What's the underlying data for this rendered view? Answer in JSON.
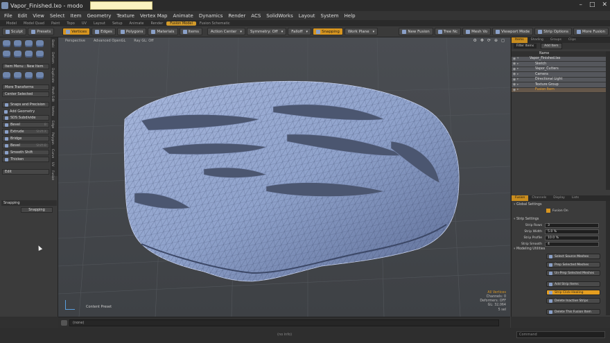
{
  "window": {
    "title": "Vapor_Finished.lxo - modo",
    "controls": [
      "–",
      "□",
      "✕"
    ]
  },
  "menu": [
    "File",
    "Edit",
    "View",
    "Select",
    "Item",
    "Geometry",
    "Texture",
    "Vertex Map",
    "Animate",
    "Dynamics",
    "Render",
    "ACS",
    "SolidWorks",
    "Layout",
    "System",
    "Help"
  ],
  "layout_tabs": [
    {
      "label": "Model",
      "active": false
    },
    {
      "label": "Model Quad",
      "active": false
    },
    {
      "label": "Paint",
      "active": false
    },
    {
      "label": "Topo",
      "active": false
    },
    {
      "label": "UV",
      "active": false
    },
    {
      "label": "Layout",
      "active": false
    },
    {
      "label": "Setup",
      "active": false
    },
    {
      "label": "Animate",
      "active": false
    },
    {
      "label": "Render",
      "active": false
    },
    {
      "label": "Fusion Model",
      "active": true
    },
    {
      "label": "Fusion Schematic",
      "active": false
    }
  ],
  "toolbar": {
    "sculpt": "Sculpt",
    "presets": "Presets",
    "vertices": "Vertices",
    "edges": "Edges",
    "polygons": "Polygons",
    "materials": "Materials",
    "items": "Items",
    "action_center": "Action Center",
    "symmetry": "Symmetry: Off",
    "falloff": "Falloff",
    "snapping": "Snapping",
    "work_plane": "Work Plane",
    "new_fusion": "New Fusion",
    "tree_nc": "Tree Nc",
    "mesh_vo": "Mesh Vo",
    "viewport_mode": "Viewport Mode",
    "strip_options": "Strip Options",
    "more_fusion": "More Fusion"
  },
  "left_panel": {
    "vtabs": [
      "Basic",
      "Deform",
      "Duplicate",
      "Mesh Edit",
      "Vertex",
      "Edge",
      "Polygon",
      "Curve",
      "UV",
      "Fusion"
    ],
    "item_menu": "Item Menu : New Item",
    "more_transforms": "More Transforms",
    "center_selected": "Center Selected",
    "snaps": "Snaps and Precision",
    "add_geometry": "Add Geometry",
    "tools": [
      {
        "label": "SDS Subdivide",
        "hotkey": ""
      },
      {
        "label": "Bevel",
        "hotkey": "B"
      },
      {
        "label": "Extrude",
        "hotkey": "Shift-X"
      },
      {
        "label": "Bridge",
        "hotkey": ""
      },
      {
        "label": "Bevel",
        "hotkey": "Shift-B"
      },
      {
        "label": "Smooth Shift",
        "hotkey": ""
      },
      {
        "label": "Thicken",
        "hotkey": ""
      }
    ],
    "edit": "Edit",
    "snapping_header": "Snapping",
    "snapping_button": "Snapping"
  },
  "viewport": {
    "view_mode": "Perspective",
    "shading": "Advanced OpenGL",
    "ray_gl": "Ray GL: Off",
    "preset_label": "Content Preset",
    "stats": {
      "sel": "All Vertices",
      "channels": "Channels: 0",
      "deformers": "Deformers: OFF",
      "gl": "GL: 32,064",
      "count": "5 sel"
    }
  },
  "command_line": "(none)",
  "status_message": "(no info)",
  "command_placeholder": "Command",
  "item_list": {
    "tabs": [
      {
        "label": "Items",
        "active": true
      },
      {
        "label": "Shading",
        "active": false
      },
      {
        "label": "Groups",
        "active": false
      },
      {
        "label": "Clips",
        "active": false
      }
    ],
    "filter": "Filter Items",
    "add_item": "Add Item",
    "header": "Name",
    "rows": [
      {
        "label": "Vapor_Finished.lxo",
        "indent": 0,
        "sel": true,
        "hl": false
      },
      {
        "label": "Sketch",
        "indent": 1,
        "sel": true,
        "hl": false
      },
      {
        "label": "Vapor_Cutters",
        "indent": 1,
        "sel": true,
        "hl": false
      },
      {
        "label": "Camera",
        "indent": 1,
        "sel": true,
        "hl": false
      },
      {
        "label": "Directional Light",
        "indent": 1,
        "sel": true,
        "hl": false
      },
      {
        "label": "Texture Group",
        "indent": 1,
        "sel": true,
        "hl": false
      },
      {
        "label": "Fusion Item",
        "indent": 1,
        "sel": false,
        "hl": true
      }
    ]
  },
  "properties": {
    "tabs": [
      {
        "label": "Fusion",
        "active": true
      },
      {
        "label": "Channels",
        "active": false
      },
      {
        "label": "Display",
        "active": false
      },
      {
        "label": "Lists",
        "active": false
      }
    ],
    "global_settings": "Global Settings",
    "fusion_on": "Fusion On",
    "strip_settings": "Strip Settings",
    "fields": [
      {
        "label": "Strip Rows",
        "value": "3"
      },
      {
        "label": "Strip Width",
        "value": "5.0 %"
      },
      {
        "label": "Strip Profile",
        "value": "10.0 %"
      },
      {
        "label": "Strip Smooth",
        "value": "4"
      }
    ],
    "modeling_utilities": "Modeling Utilities",
    "buttons": [
      {
        "label": "Select Source Meshes",
        "on": false
      },
      {
        "label": "Prep Selected Meshes",
        "on": false
      },
      {
        "label": "Un-Prep Selected Meshes",
        "on": false
      },
      {
        "label": "Add Strip Items",
        "on": false
      },
      {
        "label": "Strip Click-Healing",
        "on": true
      },
      {
        "label": "Delete Inactive Strips",
        "on": false
      },
      {
        "label": "Delete This Fusion Item",
        "on": false
      }
    ]
  },
  "colors": {
    "accent": "#d7951f",
    "mesh": "#8da1c9",
    "mesh_dark": "#4c5a7a",
    "viewport_bg": "#43464a"
  }
}
